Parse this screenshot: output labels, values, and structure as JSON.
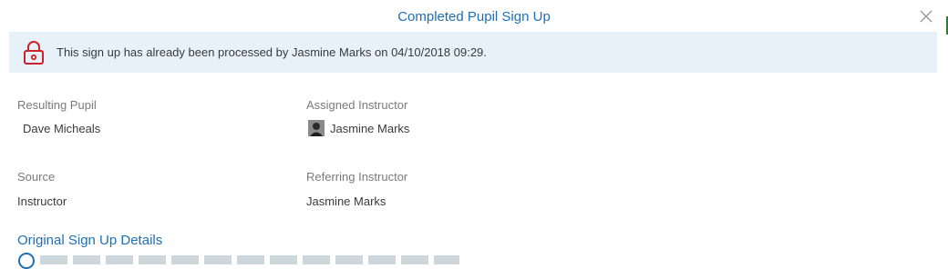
{
  "modal": {
    "title": "Completed Pupil Sign Up",
    "close_icon": "close-icon"
  },
  "banner": {
    "icon": "lock-icon",
    "message": "This sign up has already been processed by Jasmine Marks on 04/10/2018 09:29."
  },
  "fields": {
    "resulting_pupil": {
      "label": "Resulting Pupil",
      "value": "Dave Micheals"
    },
    "assigned_instructor": {
      "label": "Assigned Instructor",
      "value": "Jasmine Marks"
    },
    "source": {
      "label": "Source",
      "value": "Instructor"
    },
    "referring_instructor": {
      "label": "Referring Instructor",
      "value": "Jasmine Marks"
    }
  },
  "original_details": {
    "title": "Original Sign Up Details",
    "icon": "info-icon"
  },
  "colors": {
    "accent": "#1f6fb2",
    "banner_bg": "#e6f1f9",
    "lock_red": "#d0212b"
  }
}
